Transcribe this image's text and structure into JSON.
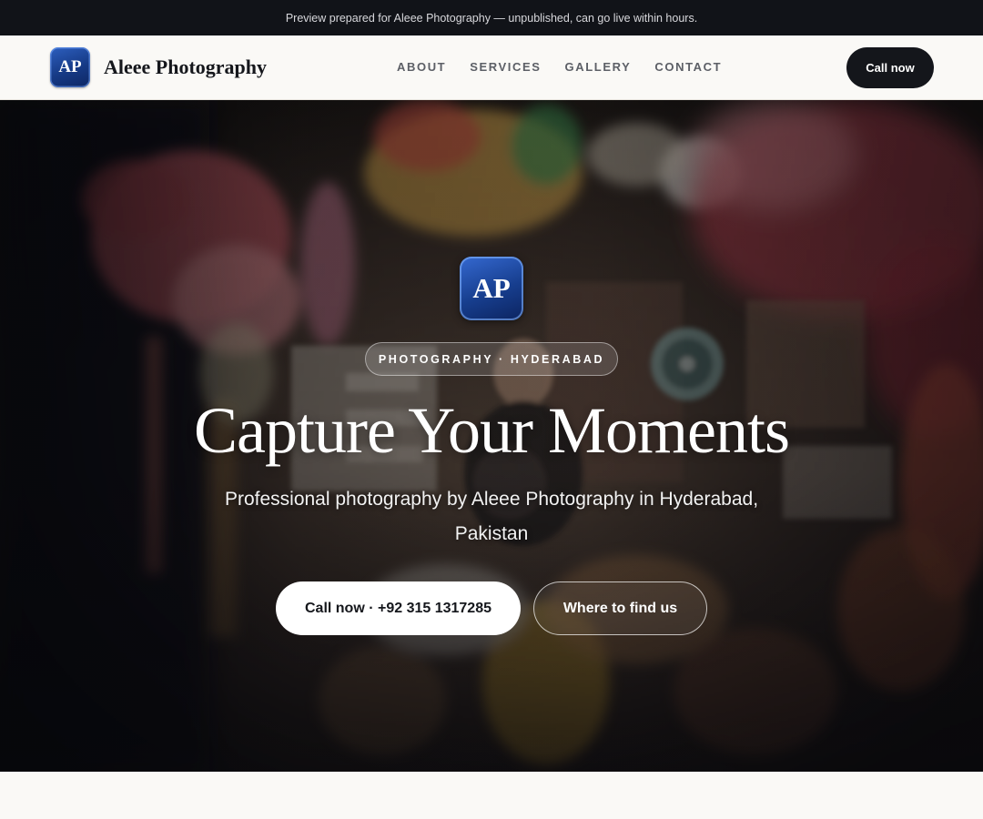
{
  "banner": {
    "text": "Preview prepared for Aleee Photography — unpublished, can go live within hours."
  },
  "header": {
    "logo_text": "AP",
    "brand_name": "Aleee Photography",
    "nav": [
      "ABOUT",
      "SERVICES",
      "GALLERY",
      "CONTACT"
    ],
    "cta_label": "Call now"
  },
  "hero": {
    "logo_text": "AP",
    "tag": "PHOTOGRAPHY · HYDERABAD",
    "title": "Capture Your Moments",
    "subtitle": "Professional photography by Aleee Photography in Hyderabad, Pakistan",
    "primary_button": "Call now · +92 315 1317285",
    "secondary_button": "Where to find us"
  },
  "colors": {
    "banner_bg": "#111318",
    "header_bg": "#faf9f6",
    "dark_button": "#14161b",
    "logo_blue": "#173e8e"
  }
}
